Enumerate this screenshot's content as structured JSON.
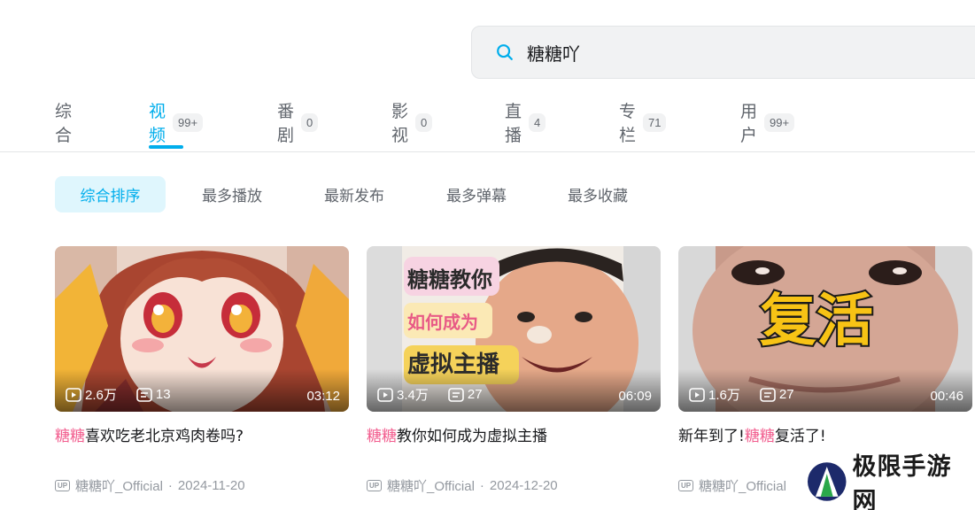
{
  "search": {
    "query": "糖糖吖",
    "icon": "search-icon"
  },
  "tabs": [
    {
      "label": "综合",
      "count": ""
    },
    {
      "label": "视频",
      "count": "99+"
    },
    {
      "label": "番剧",
      "count": "0"
    },
    {
      "label": "影视",
      "count": "0"
    },
    {
      "label": "直播",
      "count": "4"
    },
    {
      "label": "专栏",
      "count": "71"
    },
    {
      "label": "用户",
      "count": "99+"
    }
  ],
  "active_tab": "视频",
  "sorts": [
    "综合排序",
    "最多播放",
    "最新发布",
    "最多弹幕",
    "最多收藏"
  ],
  "active_sort": "综合排序",
  "videos": [
    {
      "views": "2.6万",
      "danmaku": "13",
      "duration": "03:12",
      "title_highlight": "糖糖",
      "title_prefix": "",
      "title_rest": "喜欢吃老北京鸡肉卷吗?",
      "uploader": "糖糖吖_Official",
      "date": "2024-11-20"
    },
    {
      "views": "3.4万",
      "danmaku": "27",
      "duration": "06:09",
      "title_highlight": "糖糖",
      "title_prefix": "",
      "title_rest": "教你如何成为虚拟主播",
      "uploader": "糖糖吖_Official",
      "date": "2024-12-20",
      "thumb_text": [
        "糖糖教你",
        "如何成为",
        "虚拟主播"
      ]
    },
    {
      "views": "1.6万",
      "danmaku": "27",
      "duration": "00:46",
      "title_highlight": "糖糖",
      "title_prefix": "新年到了!",
      "title_rest": "复活了!",
      "uploader": "糖糖吖_Official",
      "date": "",
      "thumb_text": [
        "复活"
      ]
    }
  ],
  "up_badge": "UP",
  "separator": "·",
  "watermark": {
    "text": "极限手游网"
  },
  "colors": {
    "accent": "#00aeec",
    "highlight": "#f25d8e",
    "muted": "#9499a0"
  }
}
